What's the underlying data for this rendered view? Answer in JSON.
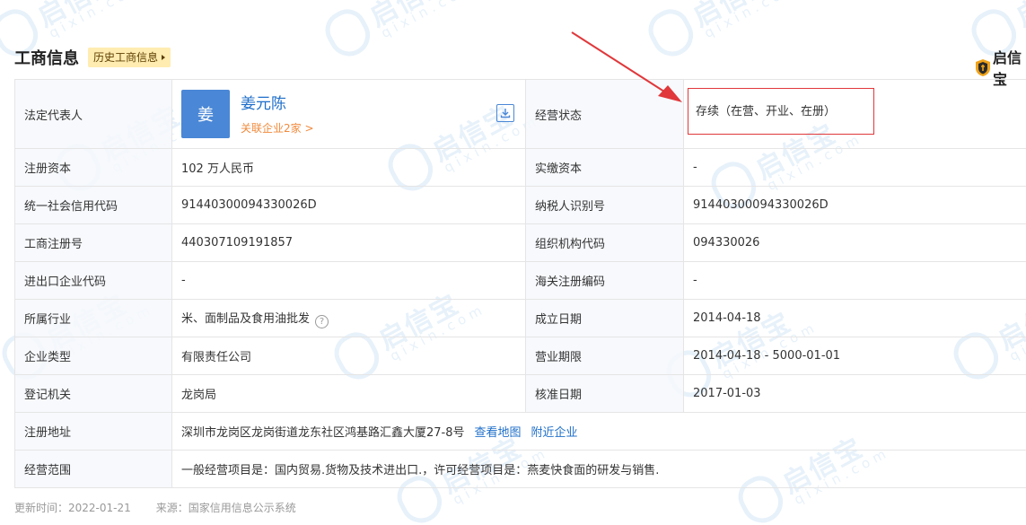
{
  "header": {
    "title": "工商信息",
    "history_button": "历史工商信息",
    "brand": "启信宝"
  },
  "watermark": {
    "text": "启信宝",
    "sub": "qixin.com"
  },
  "legal_rep": {
    "label": "法定代表人",
    "avatar_char": "姜",
    "name": "姜元陈",
    "related": "关联企业2家 >"
  },
  "status": {
    "label": "经营状态",
    "value": "存续（在营、开业、在册）"
  },
  "rows": [
    {
      "l1": "注册资本",
      "v1": "102 万人民币",
      "l2": "实缴资本",
      "v2": "-"
    },
    {
      "l1": "统一社会信用代码",
      "v1": "91440300094330026D",
      "l2": "纳税人识别号",
      "v2": "91440300094330026D"
    },
    {
      "l1": "工商注册号",
      "v1": "440307109191857",
      "l2": "组织机构代码",
      "v2": "094330026"
    },
    {
      "l1": "进出口企业代码",
      "v1": "-",
      "l2": "海关注册编码",
      "v2": "-"
    },
    {
      "l1": "所属行业",
      "v1": "米、面制品及食用油批发",
      "l2": "成立日期",
      "v2": "2014-04-18"
    },
    {
      "l1": "企业类型",
      "v1": "有限责任公司",
      "l2": "营业期限",
      "v2": "2014-04-18 - 5000-01-01"
    },
    {
      "l1": "登记机关",
      "v1": "龙岗局",
      "l2": "核准日期",
      "v2": "2017-01-03"
    }
  ],
  "address": {
    "label": "注册地址",
    "value": "深圳市龙岗区龙岗街道龙东社区鸿基路汇鑫大厦27-8号",
    "map_link": "查看地图",
    "nearby_link": "附近企业"
  },
  "scope": {
    "label": "经营范围",
    "value": "一般经营项目是：国内贸易.货物及技术进出口.，许可经营项目是：燕麦快食面的研发与销售."
  },
  "footer": {
    "updated": "更新时间：2022-01-21",
    "source": "来源：国家信用信息公示系统"
  },
  "colors": {
    "accent": "#1f6fc9",
    "highlight": "#e0383b",
    "orange": "#f08a3c",
    "badge": "#ffecb0"
  }
}
